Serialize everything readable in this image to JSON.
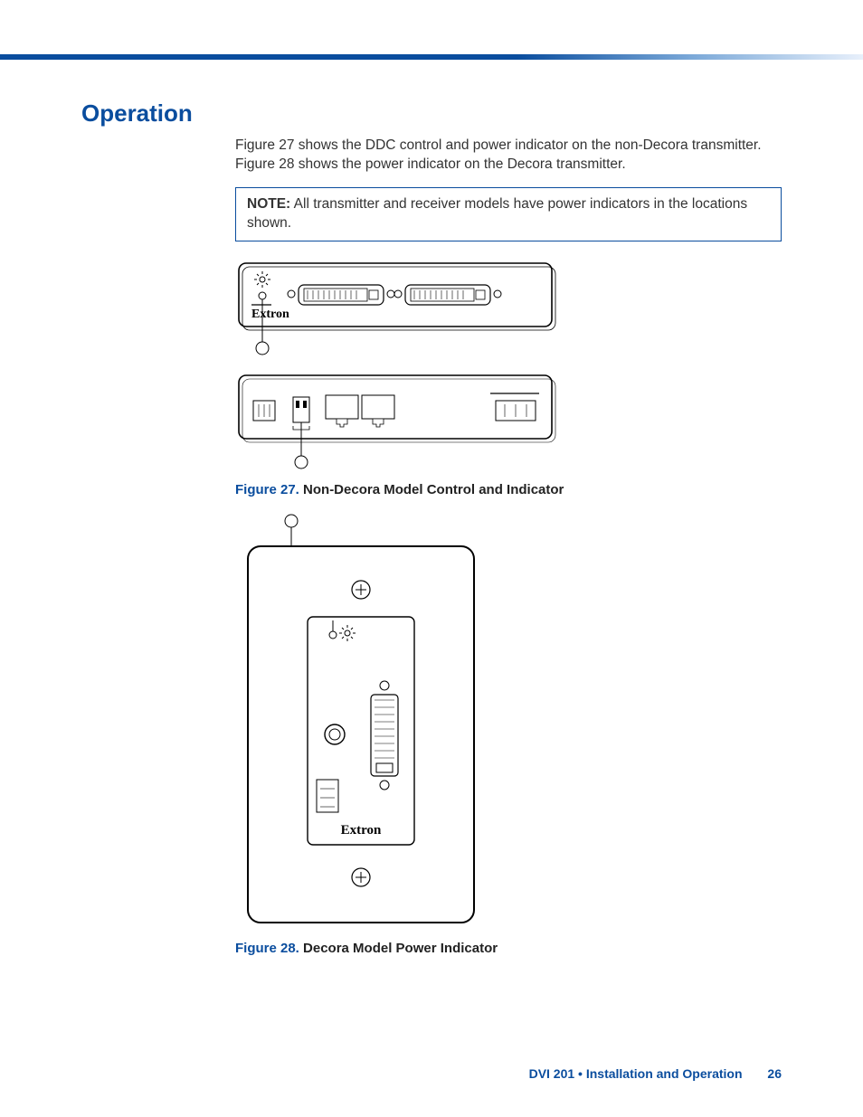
{
  "heading": "Operation",
  "intro": "Figure 27 shows the DDC control and power indicator on the non-Decora transmitter. Figure 28 shows the power indicator on the Decora transmitter.",
  "note_label": "NOTE:",
  "note_text": "All transmitter and receiver models have power indicators in the locations shown.",
  "brand": "Extron",
  "figure27_label": "Figure 27.",
  "figure27_title": "Non-Decora Model Control and Indicator",
  "figure28_label": "Figure 28.",
  "figure28_title": "Decora Model Power Indicator",
  "footer": "DVI 201 • Installation and Operation",
  "page_number": "26"
}
